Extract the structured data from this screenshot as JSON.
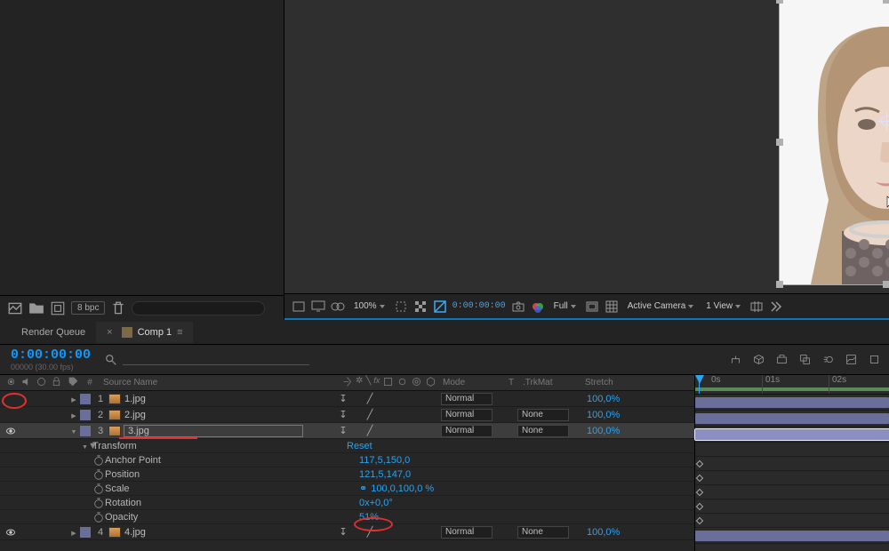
{
  "project": {
    "bpc_label": "8 bpc"
  },
  "viewer": {
    "zoom": "100%",
    "timecode": "0:00:00:00",
    "resolution": "Full",
    "camera": "Active Camera",
    "views": "1 View"
  },
  "timeline": {
    "tabs": {
      "render_queue": "Render Queue",
      "comp1": "Comp 1"
    },
    "current_time": "0:00:00:00",
    "frame_info": "00000 (30.00 fps)",
    "search_placeholder": "",
    "ruler_labels": [
      "0s",
      "01s",
      "02s"
    ],
    "columns": {
      "hash": "#",
      "source_name": "Source Name",
      "mode": "Mode",
      "t": "T",
      "trkmat": ".TrkMat",
      "stretch": "Stretch"
    },
    "layers": [
      {
        "num": "1",
        "name": "1.jpg",
        "mode": "Normal",
        "trkmat": null,
        "stretch": "100,0%",
        "visible": false,
        "expanded": false,
        "selected": false
      },
      {
        "num": "2",
        "name": "2.jpg",
        "mode": "Normal",
        "trkmat": "None",
        "stretch": "100,0%",
        "visible": false,
        "expanded": false,
        "selected": false
      },
      {
        "num": "3",
        "name": "3.jpg",
        "mode": "Normal",
        "trkmat": "None",
        "stretch": "100,0%",
        "visible": true,
        "expanded": true,
        "selected": true
      },
      {
        "num": "4",
        "name": "4.jpg",
        "mode": "Normal",
        "trkmat": "None",
        "stretch": "100,0%",
        "visible": true,
        "expanded": false,
        "selected": false
      }
    ],
    "transform_label": "Transform",
    "reset_label": "Reset",
    "props": {
      "anchor_point": {
        "label": "Anchor Point",
        "value": "117,5,150,0"
      },
      "position": {
        "label": "Position",
        "value": "121,5,147,0"
      },
      "scale": {
        "label": "Scale",
        "value": "100,0,100,0 %"
      },
      "rotation": {
        "label": "Rotation",
        "value": "0x+0,0°"
      },
      "opacity": {
        "label": "Opacity",
        "value": "51%"
      }
    }
  }
}
